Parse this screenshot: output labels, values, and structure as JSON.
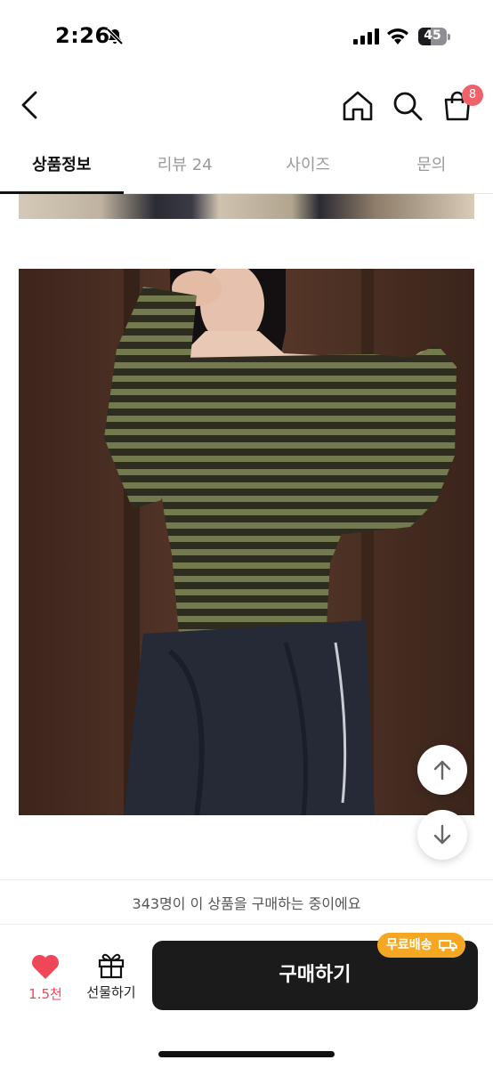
{
  "status_bar": {
    "time": "2:26",
    "battery_level": "45"
  },
  "header": {
    "cart_count": "8"
  },
  "tabs": [
    {
      "label": "상품정보",
      "active": true
    },
    {
      "label": "리뷰 24",
      "active": false
    },
    {
      "label": "사이즈",
      "active": false
    },
    {
      "label": "문의",
      "active": false
    }
  ],
  "purchase": {
    "buyers_text": "343명이 이 상품을 구매하는 중이에요",
    "like_count": "1.5천",
    "gift_label": "선물하기",
    "buy_label": "구매하기",
    "free_shipping_label": "무료배송"
  },
  "icons": [
    "bell-slash-icon",
    "cellular-signal-icon",
    "wifi-icon",
    "battery-icon",
    "back-arrow-icon",
    "home-icon",
    "search-icon",
    "cart-icon",
    "arrow-up-icon",
    "arrow-down-icon",
    "heart-icon",
    "gift-icon",
    "truck-icon"
  ],
  "colors": {
    "accent_red": "#f0465a",
    "badge": "#f0626a",
    "free_shipping": "#f5a623",
    "buy_button": "#1b1b1b"
  }
}
